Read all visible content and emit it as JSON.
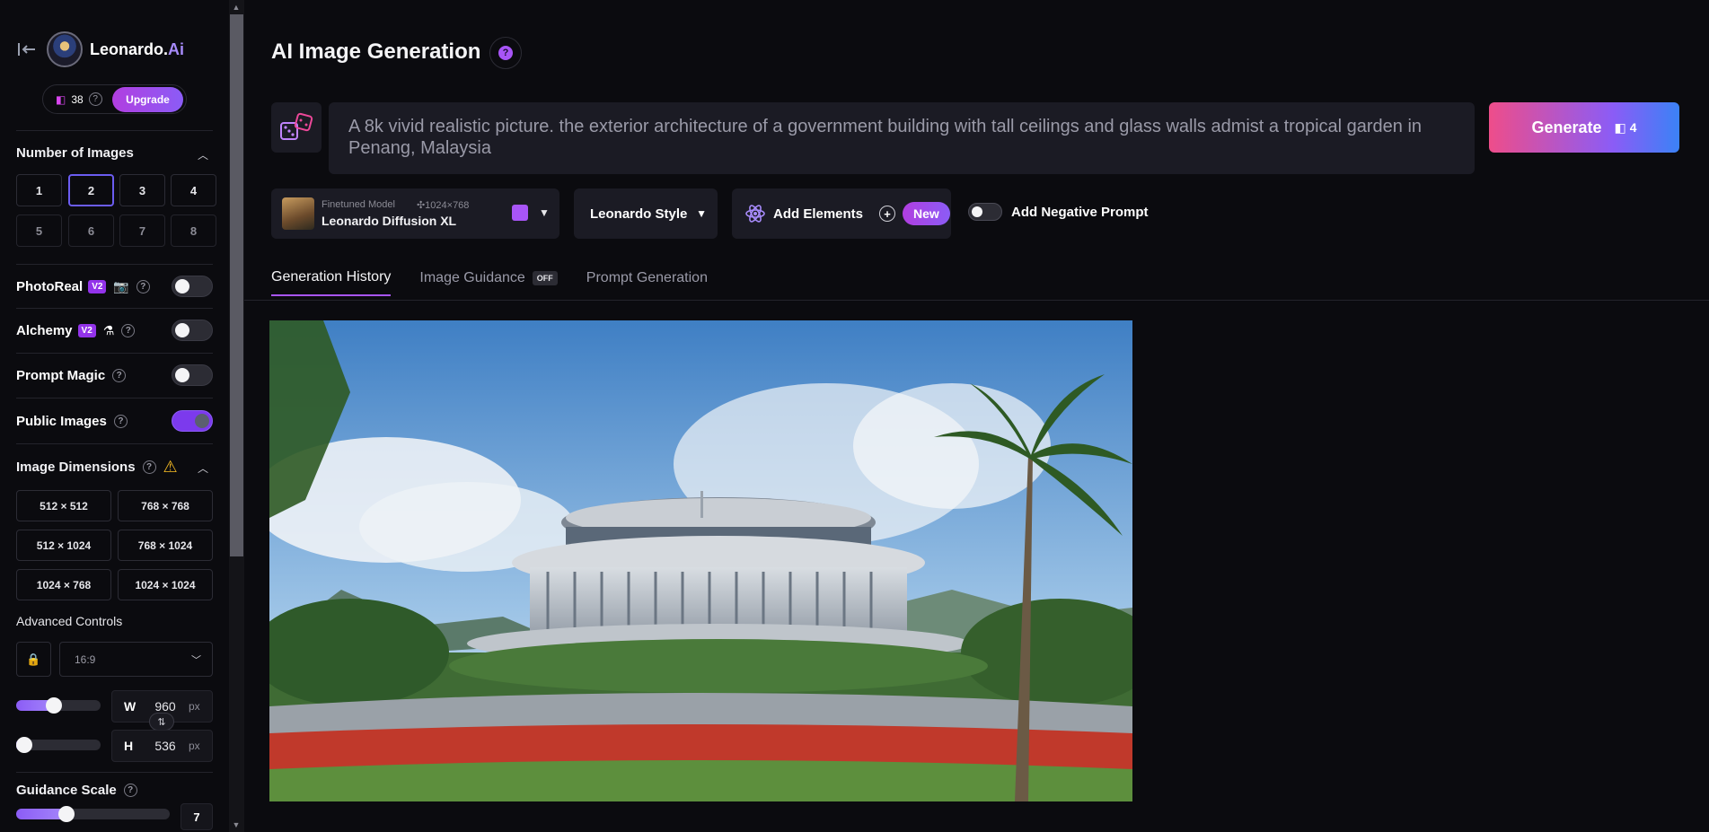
{
  "sidebar": {
    "brand": {
      "name": "Leonardo.",
      "suffix": "Ai"
    },
    "tokens": {
      "count": "38",
      "upgrade_label": "Upgrade"
    },
    "number_of_images": {
      "title": "Number of Images",
      "options": [
        "1",
        "2",
        "3",
        "4",
        "5",
        "6",
        "7",
        "8"
      ],
      "selected": "2"
    },
    "toggles": {
      "photoreal": {
        "label": "PhotoReal",
        "badge": "V2",
        "on": false
      },
      "alchemy": {
        "label": "Alchemy",
        "badge": "V2",
        "on": false
      },
      "prompt_magic": {
        "label": "Prompt Magic",
        "on": false
      },
      "public_images": {
        "label": "Public Images",
        "on": true
      }
    },
    "image_dimensions": {
      "title": "Image Dimensions",
      "options": [
        "512 × 512",
        "768 × 768",
        "512 × 1024",
        "768 × 1024",
        "1024 × 768",
        "1024 × 1024"
      ]
    },
    "advanced_controls": {
      "label": "Advanced Controls",
      "aspect_ratio": "16:9",
      "width_letter": "W",
      "width": "960",
      "width_unit": "px",
      "height_letter": "H",
      "height": "536",
      "height_unit": "px",
      "width_slider_fraction": 0.43,
      "height_slider_fraction": 0.0
    },
    "guidance_scale": {
      "label": "Guidance Scale",
      "value": "7",
      "slider_fraction": 0.31
    }
  },
  "main": {
    "title": "AI Image Generation",
    "prompt": "A 8k vivid realistic picture. the exterior architecture of a government building with tall ceilings and glass walls admist a tropical garden in Penang, Malaysia",
    "generate": {
      "label": "Generate",
      "count": "4"
    },
    "model": {
      "subtitle": "Finetuned Model",
      "dims": "1024×768",
      "name": "Leonardo Diffusion XL"
    },
    "style": {
      "label": "Leonardo Style"
    },
    "elements": {
      "label": "Add Elements",
      "badge": "New"
    },
    "negative_prompt": {
      "label": "Add Negative Prompt",
      "on": false
    },
    "tabs": [
      {
        "label": "Generation History",
        "active": true
      },
      {
        "label": "Image Guidance",
        "badge": "OFF"
      },
      {
        "label": "Prompt Generation"
      }
    ]
  },
  "colors": {
    "accent": "#a855f7",
    "background": "#0b0b0f",
    "panel": "#1b1b24"
  }
}
